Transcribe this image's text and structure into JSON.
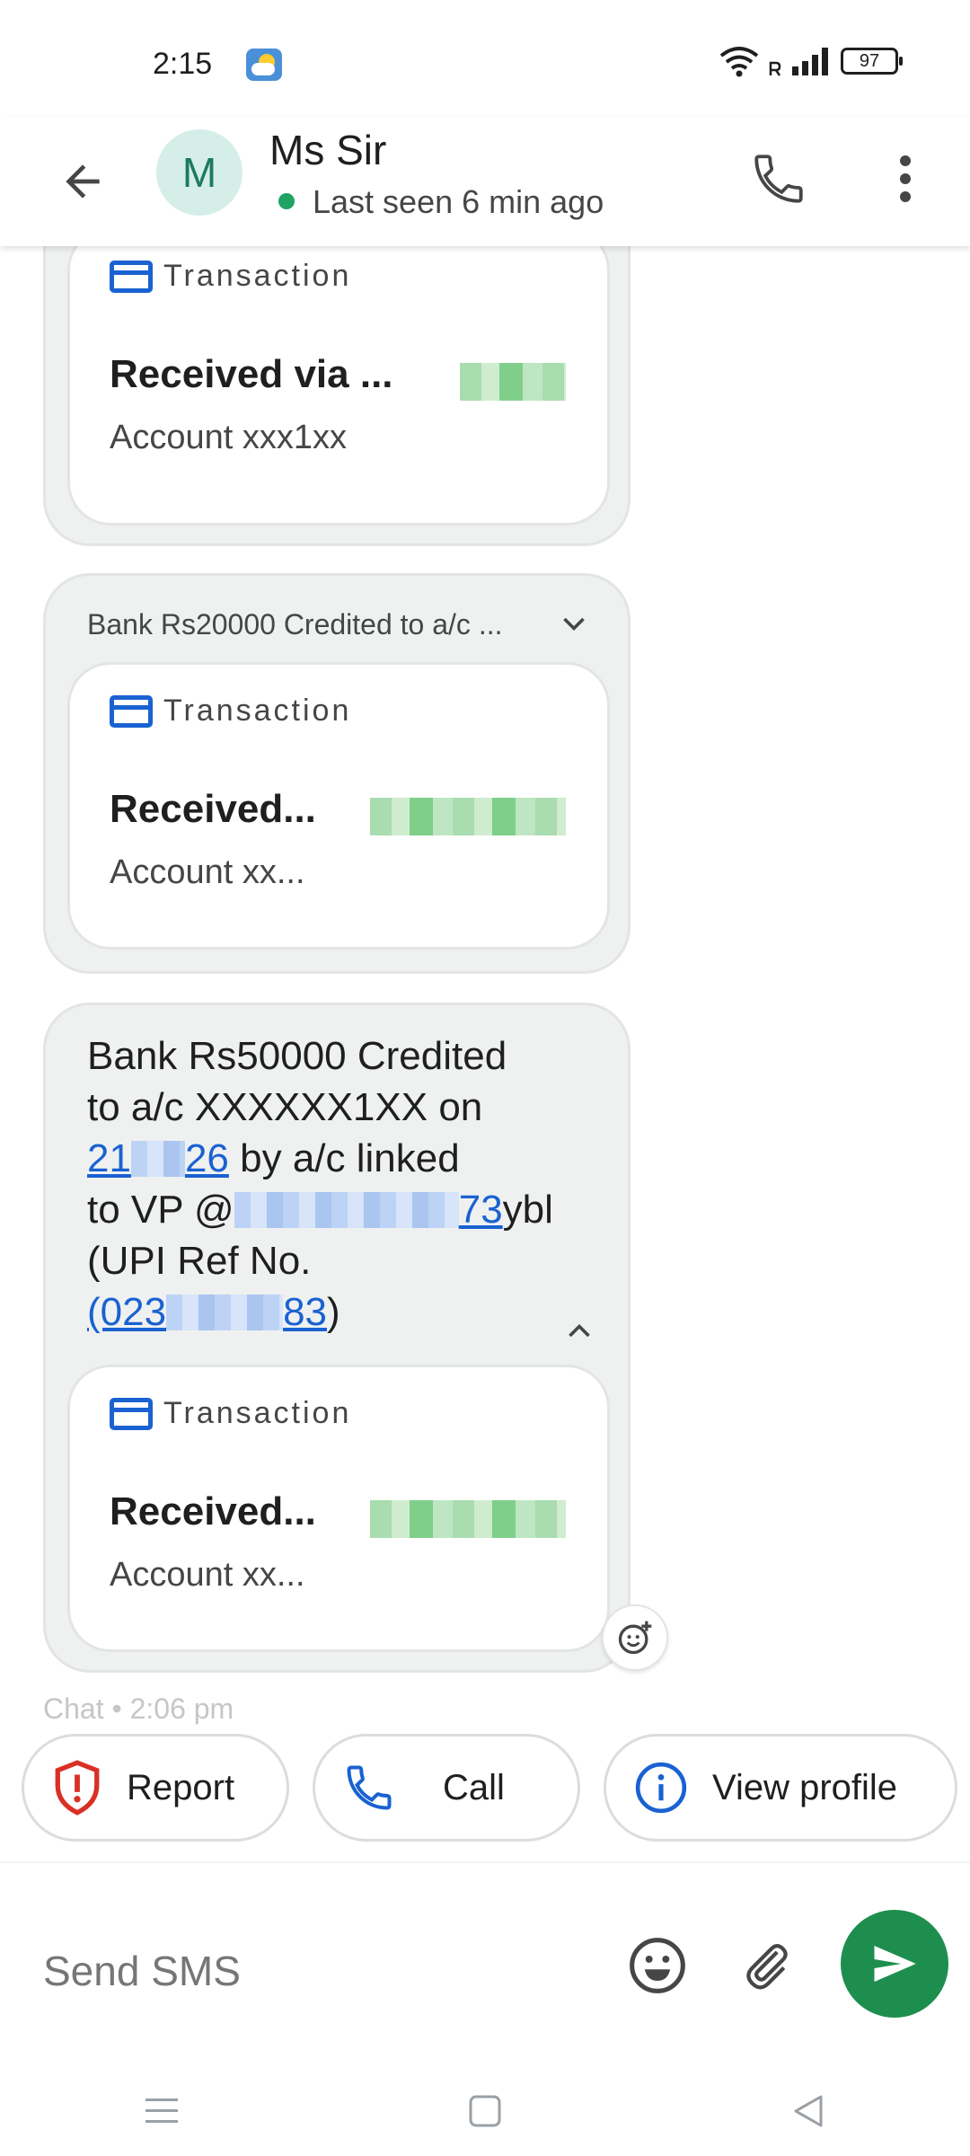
{
  "status_bar": {
    "time": "2:15",
    "battery": "97"
  },
  "header": {
    "avatar_initial": "M",
    "contact_name": "Ms Sir",
    "status": "Last seen 6 min ago"
  },
  "messages": [
    {
      "card": {
        "label": "Transaction",
        "title": "Received via ...",
        "account": "Account xxx1xx"
      }
    },
    {
      "summary": "Bank Rs20000 Credited to a/c ...",
      "card": {
        "label": "Transaction",
        "title": "Received...",
        "account": "Account xx..."
      }
    },
    {
      "text_lines": {
        "line1": "Bank Rs50000 Credited",
        "line2": "to a/c XXXXXX1XX on",
        "date_start": "21",
        "date_end": "26",
        "after_date": " by a/c linked",
        "line4_prefix": "to VP @",
        "vpa_end": "73",
        "vpa_suffix": "ybl",
        "line5": "(UPI Ref No.",
        "ref_start": "(023",
        "ref_end": "83",
        "ref_close": ")"
      },
      "card": {
        "label": "Transaction",
        "title": "Received...",
        "account": "Account xx..."
      }
    }
  ],
  "chat_meta": "Chat • 2:06 pm",
  "chips": {
    "report": "Report",
    "call": "Call",
    "view_profile": "View profile"
  },
  "compose": {
    "placeholder": "Send SMS"
  },
  "colors": {
    "accent_blue": "#1a62d1",
    "send_green": "#1e8e4e",
    "report_red": "#d93025",
    "online_green": "#1ea362"
  }
}
